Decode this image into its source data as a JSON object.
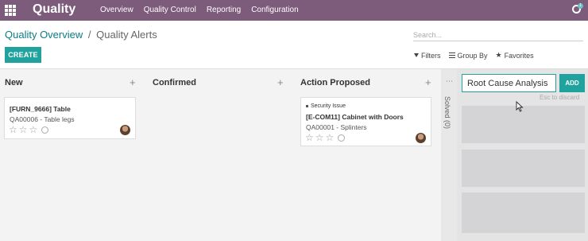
{
  "navbar": {
    "brand": "Quality",
    "menu": [
      "Overview",
      "Quality Control",
      "Reporting",
      "Configuration"
    ],
    "badge": "1"
  },
  "breadcrumb": {
    "parent": "Quality Overview",
    "separator": "/",
    "current": "Quality Alerts"
  },
  "buttons": {
    "create": "CREATE"
  },
  "search": {
    "placeholder": "Search..."
  },
  "filters": {
    "filters": "Filters",
    "group_by": "Group By",
    "favorites": "Favorites"
  },
  "columns": [
    {
      "title": "New",
      "cards": [
        {
          "title": "[FURN_9666] Table",
          "sub": "QA00006 - Table legs"
        }
      ]
    },
    {
      "title": "Confirmed",
      "cards": []
    },
    {
      "title": "Action Proposed",
      "cards": [
        {
          "tag": "Security Issue",
          "title": "[E-COM11] Cabinet with Doors",
          "sub": "QA00001 - Splinters"
        }
      ]
    }
  ],
  "folded_column": {
    "label": "Solved (0)"
  },
  "quick_add": {
    "value": "Root Cause Analysis",
    "add_label": "ADD",
    "hint": "Esc to discard"
  },
  "colors": {
    "navbar": "#7c5b7b",
    "primary": "#20a39e",
    "link": "#0a7d85"
  }
}
